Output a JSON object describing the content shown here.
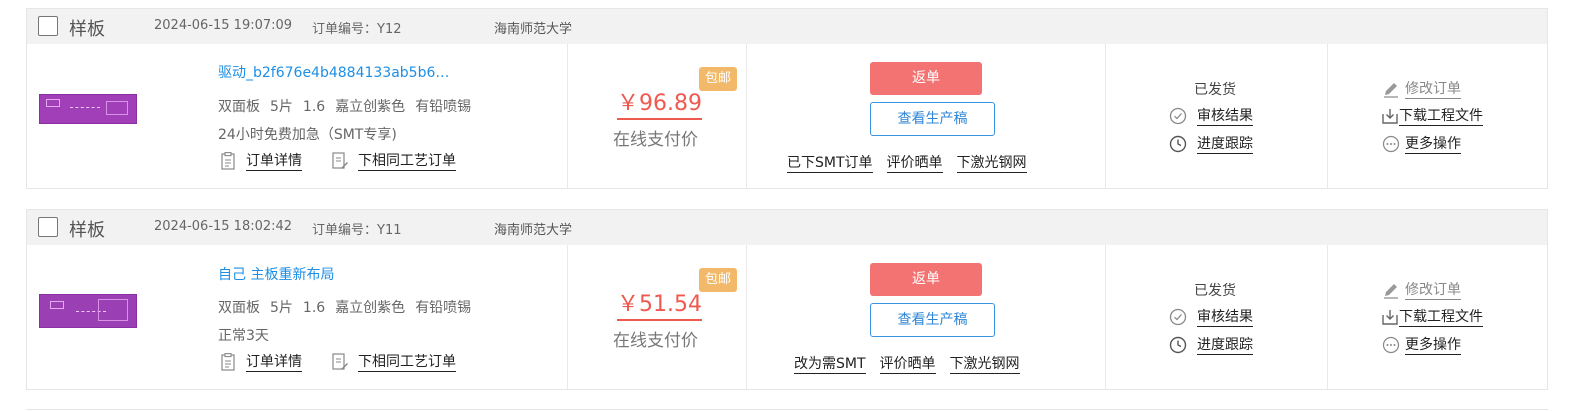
{
  "orders": [
    {
      "kind": "样板",
      "date": "2024-06-15 19:07:09",
      "order_no": "订单编号：Y12",
      "school": "海南师范大学",
      "product_name": "驱动_b2f676e4b4884133ab5b6…",
      "spec": [
        "双面板",
        "5片",
        "1.6",
        "嘉立创紫色",
        "有铅喷锡"
      ],
      "extra": "24小时免费加急（SMT专享)",
      "detail_link": "订单详情",
      "reorder_link": "下相同工艺订单",
      "price": "￥96.89",
      "badge": "包邮",
      "pay_label": "在线支付价",
      "return_btn": "返单",
      "prod_btn": "查看生产稿",
      "op_links": [
        "已下SMT订单",
        "评价晒单",
        "下激光钢网"
      ],
      "status": "已发货",
      "review_link": "审核结果",
      "track_link": "进度跟踪",
      "modify_link": "修改订单",
      "download_link": "下载工程文件",
      "more_link": "更多操作"
    },
    {
      "kind": "样板",
      "date": "2024-06-15 18:02:42",
      "order_no": "订单编号：Y11",
      "school": "海南师范大学",
      "product_name": "自己 主板重新布局",
      "spec": [
        "双面板",
        "5片",
        "1.6",
        "嘉立创紫色",
        "有铅喷锡"
      ],
      "extra": "正常3天",
      "detail_link": "订单详情",
      "reorder_link": "下相同工艺订单",
      "price": "￥51.54",
      "badge": "包邮",
      "pay_label": "在线支付价",
      "return_btn": "返单",
      "prod_btn": "查看生产稿",
      "op_links": [
        "改为需SMT",
        "评价晒单",
        "下激光钢网"
      ],
      "status": "已发货",
      "review_link": "审核结果",
      "track_link": "进度跟踪",
      "modify_link": "修改订单",
      "download_link": "下载工程文件",
      "more_link": "更多操作"
    }
  ]
}
